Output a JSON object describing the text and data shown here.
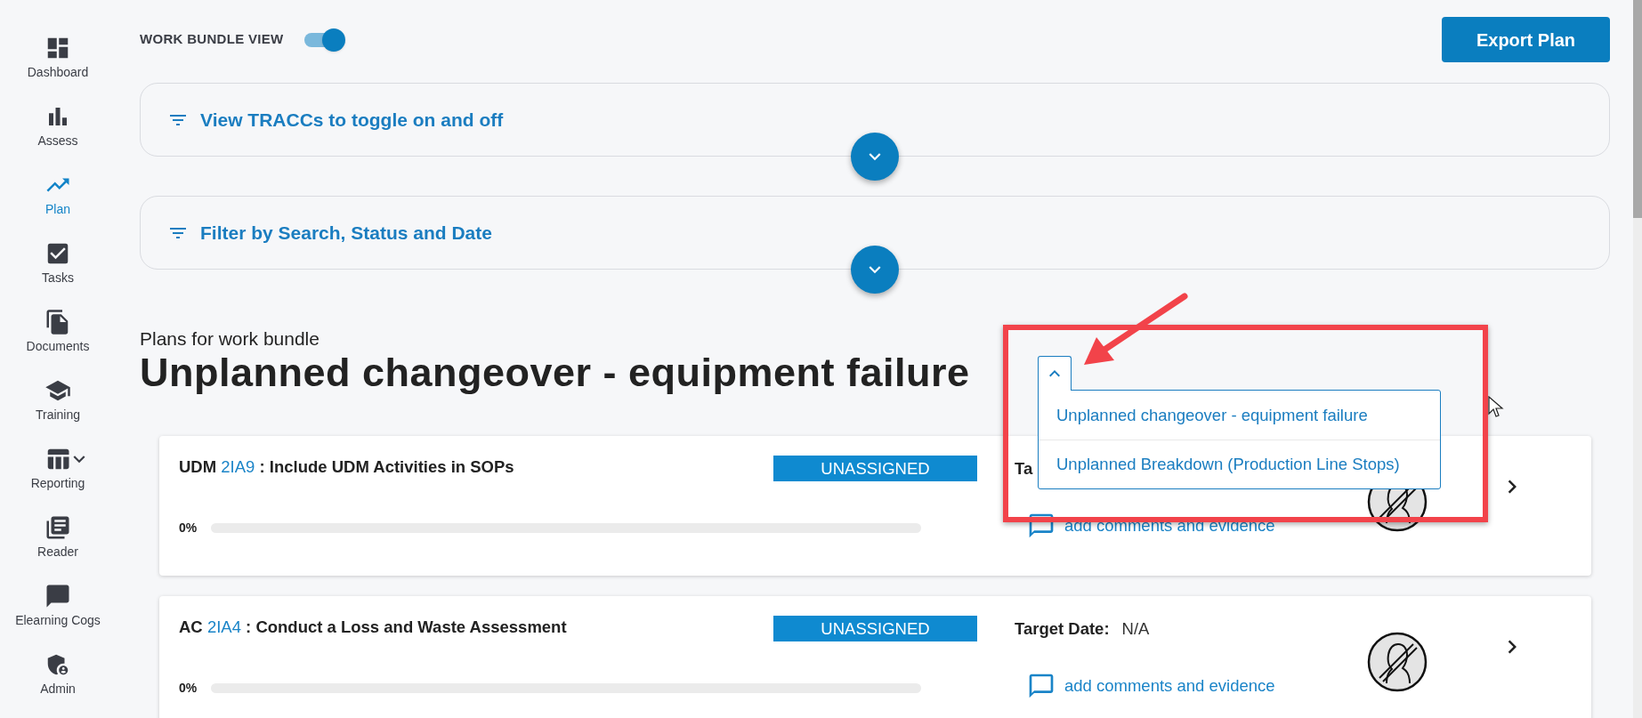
{
  "sidebar": {
    "items": [
      {
        "label": "Dashboard",
        "kind": "dashboard",
        "selected": false
      },
      {
        "label": "Assess",
        "kind": "assess",
        "selected": false
      },
      {
        "label": "Plan",
        "kind": "plan",
        "selected": true
      },
      {
        "label": "Tasks",
        "kind": "tasks",
        "selected": false
      },
      {
        "label": "Documents",
        "kind": "documents",
        "selected": false
      },
      {
        "label": "Training",
        "kind": "training",
        "selected": false
      },
      {
        "label": "Reporting",
        "kind": "reporting",
        "selected": false,
        "expanded": false
      },
      {
        "label": "Reader",
        "kind": "reader",
        "selected": false
      },
      {
        "label": "Elearning Cogs",
        "kind": "chat",
        "selected": false
      },
      {
        "label": "Admin",
        "kind": "admin",
        "selected": false
      }
    ]
  },
  "toggle": {
    "label": "WORK BUNDLE VIEW",
    "on": true
  },
  "export_button": "Export Plan",
  "accordions": [
    {
      "title": "View TRACCs to toggle on and off",
      "expanded": false
    },
    {
      "title": "Filter by Search, Status and Date",
      "expanded": false
    }
  ],
  "heading": {
    "subtitle": "Plans for work bundle",
    "title": "Unplanned changeover - equipment failure"
  },
  "bundle_dropdown": {
    "expanded": true,
    "options": [
      {
        "label": "Unplanned changeover - equipment failure"
      },
      {
        "label": "Unplanned Breakdown (Production Line Stops)"
      }
    ]
  },
  "plans": [
    {
      "code": "UDM",
      "id": "2IA9",
      "separator": ":",
      "title": "Include UDM Activities in SOPs",
      "status": "UNASSIGNED",
      "target_label": "Ta",
      "progress_label": "0%",
      "level": 0,
      "comments": "add comments and evidence"
    },
    {
      "code": "AC",
      "id": "2IA4",
      "separator": ":",
      "title": "Conduct a Loss and Waste Assessment",
      "status": "UNASSIGNED",
      "target_label": "Target Date:",
      "target_value": "N/A",
      "progress_label": "0%",
      "level": 0,
      "comments": "add comments and evidence"
    }
  ]
}
